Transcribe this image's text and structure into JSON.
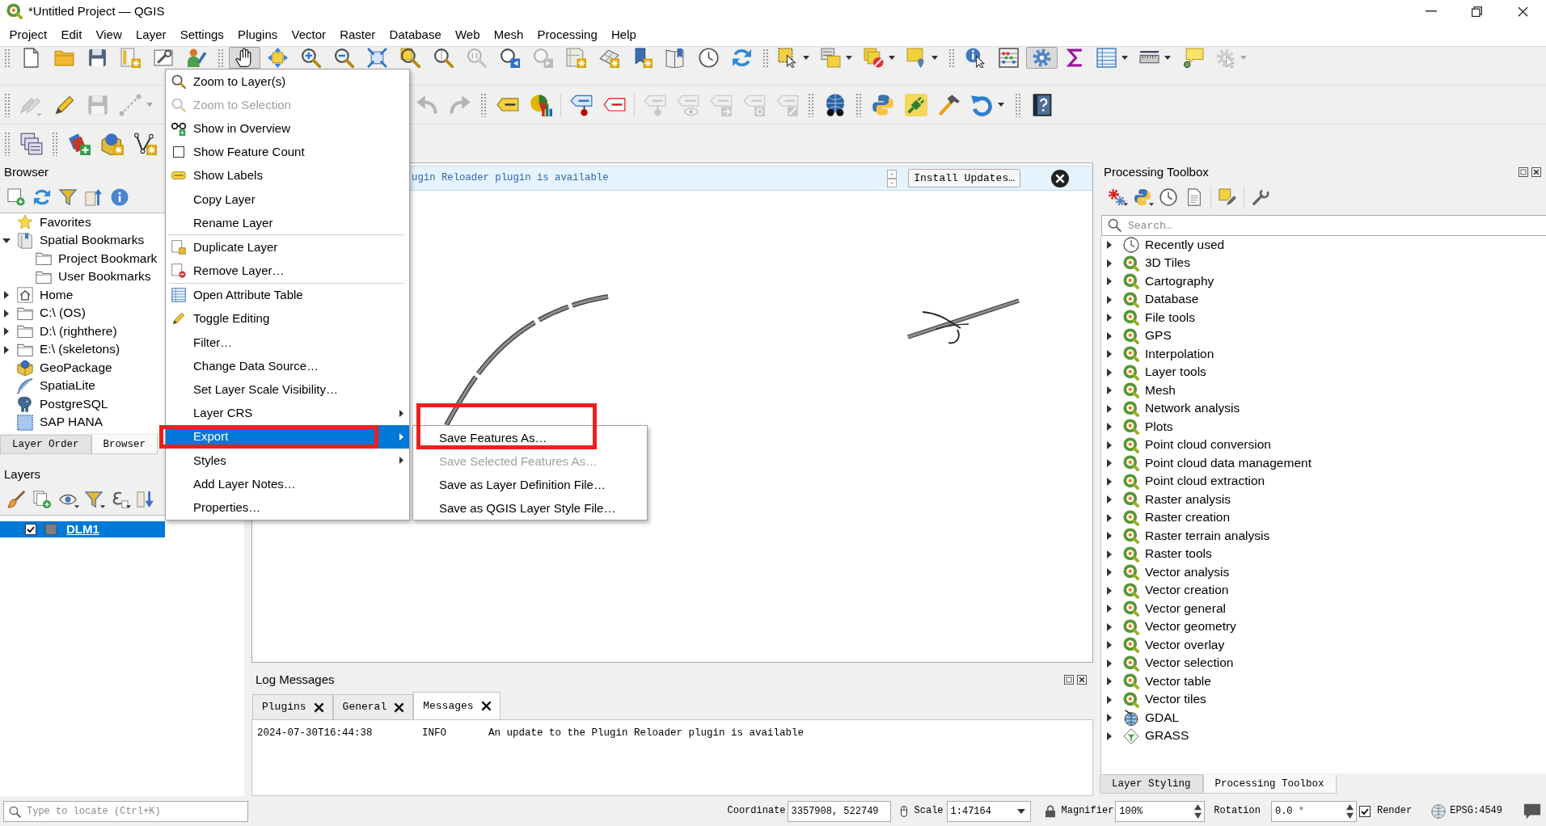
{
  "window": {
    "title": "*Untitled Project — QGIS"
  },
  "menu_bar": [
    {
      "label": "Project"
    },
    {
      "label": "Edit"
    },
    {
      "label": "View"
    },
    {
      "label": "Layer"
    },
    {
      "label": "Settings"
    },
    {
      "label": "Plugins"
    },
    {
      "label": "Vector"
    },
    {
      "label": "Raster"
    },
    {
      "label": "Database"
    },
    {
      "label": "Web"
    },
    {
      "label": "Mesh"
    },
    {
      "label": "Processing"
    },
    {
      "label": "Help"
    }
  ],
  "toolbars": [
    {
      "groups": [
        {
          "grip": true,
          "items": [
            {
              "kind": "new",
              "disabled": false,
              "pressed": false,
              "menu": false
            },
            {
              "kind": "open",
              "disabled": false,
              "pressed": false,
              "menu": false
            },
            {
              "kind": "save",
              "disabled": false,
              "pressed": false,
              "menu": false
            },
            {
              "kind": "template",
              "disabled": false,
              "pressed": false,
              "menu": false
            },
            {
              "kind": "style",
              "disabled": false,
              "pressed": false,
              "menu": false
            },
            {
              "kind": "profile",
              "disabled": false,
              "pressed": false,
              "menu": false
            }
          ]
        },
        {
          "grip": true,
          "items": [
            {
              "kind": "pan",
              "disabled": false,
              "pressed": true,
              "menu": false
            },
            {
              "kind": "pansel",
              "disabled": false,
              "pressed": false,
              "menu": false
            },
            {
              "kind": "zoomin",
              "disabled": false,
              "pressed": false,
              "menu": false
            },
            {
              "kind": "zoomout",
              "disabled": false,
              "pressed": false,
              "menu": false
            },
            {
              "kind": "zoomfull",
              "disabled": false,
              "pressed": false,
              "menu": false
            },
            {
              "kind": "zoomsel",
              "disabled": false,
              "pressed": false,
              "menu": false
            },
            {
              "kind": "zoomlayer",
              "disabled": false,
              "pressed": false,
              "menu": false
            },
            {
              "kind": "zoomnative",
              "disabled": true,
              "pressed": false,
              "menu": false
            },
            {
              "kind": "zoomlast",
              "disabled": false,
              "pressed": false,
              "menu": false
            },
            {
              "kind": "zoomnext",
              "disabled": true,
              "pressed": false,
              "menu": false
            },
            {
              "kind": "newmap",
              "disabled": false,
              "pressed": false,
              "menu": false
            },
            {
              "kind": "new3d",
              "disabled": false,
              "pressed": false,
              "menu": false
            },
            {
              "kind": "newbm",
              "disabled": false,
              "pressed": false,
              "menu": false
            },
            {
              "kind": "bookmarks",
              "disabled": false,
              "pressed": false,
              "menu": false
            },
            {
              "kind": "clock",
              "disabled": false,
              "pressed": false,
              "menu": false
            },
            {
              "kind": "refresh",
              "disabled": false,
              "pressed": false,
              "menu": false
            }
          ]
        },
        {
          "grip": true,
          "items": [
            {
              "kind": "select",
              "disabled": false,
              "pressed": false,
              "menu": true
            },
            {
              "kind": "selattr",
              "disabled": false,
              "pressed": false,
              "menu": true
            },
            {
              "kind": "deselect",
              "disabled": false,
              "pressed": false,
              "menu": true
            },
            {
              "kind": "selloc",
              "disabled": false,
              "pressed": false,
              "menu": true
            }
          ]
        },
        {
          "grip": true,
          "items": [
            {
              "kind": "identify",
              "disabled": false,
              "pressed": false,
              "menu": false
            },
            {
              "kind": "stats",
              "disabled": false,
              "pressed": false,
              "menu": false
            },
            {
              "kind": "toolbox",
              "disabled": false,
              "pressed": true,
              "menu": false
            },
            {
              "kind": "sigma",
              "disabled": false,
              "pressed": false,
              "menu": false
            },
            {
              "kind": "table",
              "disabled": false,
              "pressed": false,
              "menu": true
            },
            {
              "kind": "measure",
              "disabled": false,
              "pressed": false,
              "menu": true
            },
            {
              "kind": "maptips",
              "disabled": false,
              "pressed": false,
              "menu": false
            },
            {
              "kind": "action",
              "disabled": true,
              "pressed": false,
              "menu": true
            }
          ]
        }
      ]
    },
    {
      "groups": [
        {
          "grip": true,
          "items": [
            {
              "kind": "multiedit",
              "disabled": true,
              "pressed": false,
              "menu": false
            },
            {
              "kind": "pencil",
              "disabled": false,
              "pressed": false,
              "menu": false
            },
            {
              "kind": "saveedits",
              "disabled": true,
              "pressed": false,
              "menu": false
            },
            {
              "kind": "addfeat",
              "disabled": true,
              "pressed": false,
              "menu": true
            },
            {
              "kind": "undo",
              "disabled": true,
              "pressed": false,
              "menu": false
            },
            {
              "kind": "redo",
              "disabled": true,
              "pressed": false,
              "menu": false
            }
          ]
        },
        {
          "grip": true,
          "items": [
            {
              "kind": "label",
              "disabled": false,
              "pressed": false,
              "menu": false
            },
            {
              "kind": "diagram",
              "disabled": false,
              "pressed": false,
              "menu": false
            },
            {
              "kind": "separator"
            },
            {
              "kind": "labelpin",
              "disabled": false,
              "pressed": false,
              "menu": false
            },
            {
              "kind": "labelred",
              "disabled": false,
              "pressed": false,
              "menu": false
            },
            {
              "kind": "separator"
            },
            {
              "kind": "lblpin",
              "disabled": true,
              "pressed": false,
              "menu": false
            },
            {
              "kind": "lbleye",
              "disabled": true,
              "pressed": false,
              "menu": false
            },
            {
              "kind": "lblarrow",
              "disabled": true,
              "pressed": false,
              "menu": false
            },
            {
              "kind": "lblrot",
              "disabled": true,
              "pressed": false,
              "menu": false
            },
            {
              "kind": "lblpen",
              "disabled": true,
              "pressed": false,
              "menu": false
            }
          ]
        },
        {
          "grip": true,
          "items": [
            {
              "kind": "globe",
              "disabled": false,
              "pressed": false,
              "menu": false
            }
          ]
        },
        {
          "grip": true,
          "items": [
            {
              "kind": "python",
              "disabled": false,
              "pressed": false,
              "menu": false
            },
            {
              "kind": "plugin",
              "disabled": false,
              "pressed": false,
              "menu": false
            },
            {
              "kind": "hammer",
              "disabled": false,
              "pressed": false,
              "menu": false
            },
            {
              "kind": "reload",
              "disabled": false,
              "pressed": false,
              "menu": true
            }
          ]
        },
        {
          "grip": true,
          "items": [
            {
              "kind": "help",
              "disabled": false,
              "pressed": false,
              "menu": false
            }
          ]
        }
      ]
    },
    {
      "groups": [
        {
          "grip": true,
          "items": [
            {
              "kind": "layerstack",
              "disabled": false,
              "pressed": false,
              "menu": false
            }
          ]
        },
        {
          "grip": true,
          "items": [
            {
              "kind": "addlayer",
              "disabled": false,
              "pressed": false,
              "menu": false
            },
            {
              "kind": "globebox",
              "disabled": false,
              "pressed": false,
              "menu": false
            },
            {
              "kind": "vertex",
              "disabled": false,
              "pressed": false,
              "menu": false
            }
          ]
        }
      ]
    }
  ],
  "browser": {
    "title": "Browser",
    "toolbar": [
      {
        "kind": "addsheet",
        "menu": false
      },
      {
        "kind": "refresh",
        "menu": false
      },
      {
        "kind": "filter",
        "menu": false
      },
      {
        "kind": "collapse",
        "menu": false
      },
      {
        "kind": "info",
        "menu": false
      }
    ],
    "items": [
      {
        "label": "Favorites",
        "kind": "favorites"
      },
      {
        "label": "Spatial Bookmarks",
        "kind": "bookmarks",
        "expanded": true,
        "children": [
          {
            "label": "Project Bookmark",
            "kind": "folder"
          },
          {
            "label": "User Bookmarks",
            "kind": "folder"
          }
        ]
      },
      {
        "label": "Home",
        "kind": "home",
        "expanded": false
      },
      {
        "label": "C:\\ (OS)",
        "kind": "drive",
        "expanded": false
      },
      {
        "label": "D:\\ (righthere)",
        "kind": "drive",
        "expanded": false
      },
      {
        "label": "E:\\ (skeletons)",
        "kind": "drive",
        "expanded": false
      },
      {
        "label": "GeoPackage",
        "kind": "geopackage"
      },
      {
        "label": "SpatiaLite",
        "kind": "spatialite"
      },
      {
        "label": "PostgreSQL",
        "kind": "postgres"
      },
      {
        "label": "SAP HANA",
        "kind": "hana"
      }
    ],
    "tabs": [
      {
        "label": "Layer Order",
        "selected": false
      },
      {
        "label": "Browser",
        "selected": true
      }
    ]
  },
  "layers": {
    "title": "Layers",
    "toolbar": [
      {
        "kind": "brush",
        "menu": false
      },
      {
        "kind": "addgroup",
        "menu": false
      },
      {
        "kind": "eye",
        "menu": true
      },
      {
        "kind": "filter",
        "menu": true
      },
      {
        "kind": "epsilon",
        "menu": true
      },
      {
        "kind": "down",
        "menu": false
      }
    ],
    "items": [
      {
        "name": "DLM1",
        "checked": true,
        "selected": true
      }
    ]
  },
  "map": {
    "message_bar": {
      "text": "ugin Reloader plugin is available",
      "button": "Install Updates…"
    }
  },
  "log_messages": {
    "title": "Log Messages",
    "tabs": [
      {
        "label": "Plugins",
        "selected": false
      },
      {
        "label": "General",
        "selected": false
      },
      {
        "label": "Messages",
        "selected": true
      }
    ],
    "rows": [
      {
        "time": "2024-07-30T16:44:38",
        "level": "INFO",
        "message": "An update to the Plugin Reloader plugin is available"
      }
    ]
  },
  "processing_toolbox": {
    "title": "Processing Toolbox",
    "toolbar": [
      {
        "kind": "gears",
        "menu": true
      },
      {
        "kind": "python",
        "menu": true
      },
      {
        "kind": "clock",
        "menu": false
      },
      {
        "kind": "doc",
        "menu": false
      },
      {
        "kind": "separator"
      },
      {
        "kind": "tagpen",
        "menu": false
      },
      {
        "kind": "separator"
      },
      {
        "kind": "wrench",
        "menu": false
      }
    ],
    "search": {
      "placeholder": "Search…"
    },
    "items": [
      {
        "label": "Recently used",
        "kind": "recent",
        "expanded": false
      },
      {
        "label": "3D Tiles",
        "kind": "provider",
        "expanded": false
      },
      {
        "label": "Cartography",
        "kind": "provider",
        "expanded": false
      },
      {
        "label": "Database",
        "kind": "provider",
        "expanded": false
      },
      {
        "label": "File tools",
        "kind": "provider",
        "expanded": false
      },
      {
        "label": "GPS",
        "kind": "provider",
        "expanded": false
      },
      {
        "label": "Interpolation",
        "kind": "provider",
        "expanded": false
      },
      {
        "label": "Layer tools",
        "kind": "provider",
        "expanded": false
      },
      {
        "label": "Mesh",
        "kind": "provider",
        "expanded": false
      },
      {
        "label": "Network analysis",
        "kind": "provider",
        "expanded": false
      },
      {
        "label": "Plots",
        "kind": "provider",
        "expanded": false
      },
      {
        "label": "Point cloud conversion",
        "kind": "provider",
        "expanded": false
      },
      {
        "label": "Point cloud data management",
        "kind": "provider",
        "expanded": false
      },
      {
        "label": "Point cloud extraction",
        "kind": "provider",
        "expanded": false
      },
      {
        "label": "Raster analysis",
        "kind": "provider",
        "expanded": false
      },
      {
        "label": "Raster creation",
        "kind": "provider",
        "expanded": false
      },
      {
        "label": "Raster terrain analysis",
        "kind": "provider",
        "expanded": false
      },
      {
        "label": "Raster tools",
        "kind": "provider",
        "expanded": false
      },
      {
        "label": "Vector analysis",
        "kind": "provider",
        "expanded": false
      },
      {
        "label": "Vector creation",
        "kind": "provider",
        "expanded": false
      },
      {
        "label": "Vector general",
        "kind": "provider",
        "expanded": false
      },
      {
        "label": "Vector geometry",
        "kind": "provider",
        "expanded": false
      },
      {
        "label": "Vector overlay",
        "kind": "provider",
        "expanded": false
      },
      {
        "label": "Vector selection",
        "kind": "provider",
        "expanded": false
      },
      {
        "label": "Vector table",
        "kind": "provider",
        "expanded": false
      },
      {
        "label": "Vector tiles",
        "kind": "provider",
        "expanded": false
      },
      {
        "label": "GDAL",
        "kind": "gdal",
        "expanded": false
      },
      {
        "label": "GRASS",
        "kind": "grass",
        "expanded": false
      }
    ]
  },
  "right_dock_tabs": [
    {
      "label": "Layer Styling",
      "selected": false
    },
    {
      "label": "Processing Toolbox",
      "selected": true
    }
  ],
  "status_bar": {
    "locate": {
      "placeholder": "Type to locate (Ctrl+K)"
    },
    "coordinate_label": "Coordinate",
    "coordinate": "3357908, 522749",
    "scale_label": "Scale",
    "scale": "1:47164",
    "magnifier_label": "Magnifier",
    "magnifier": "100%",
    "rotation_label": "Rotation",
    "rotation": "0.0 °",
    "render": {
      "label": "Render",
      "checked": true
    },
    "crs": "EPSG:4549"
  },
  "context_menu": {
    "items": [
      {
        "kind": "zoom",
        "label": "Zoom to Layer(s)",
        "disabled": false,
        "selected": false,
        "submenu": false,
        "outlined": false
      },
      {
        "kind": "zoom",
        "label": "Zoom to Selection",
        "disabled": true,
        "selected": false,
        "submenu": false,
        "outlined": false
      },
      {
        "kind": "overview",
        "label": "Show in Overview",
        "disabled": false,
        "selected": false,
        "submenu": false,
        "outlined": false
      },
      {
        "kind": "check",
        "label": "Show Feature Count",
        "checked": false,
        "disabled": false,
        "selected": false,
        "submenu": false,
        "outlined": false
      },
      {
        "kind": "labels",
        "label": "Show Labels",
        "disabled": false,
        "selected": false,
        "submenu": false,
        "outlined": false
      },
      {
        "kind": "plain",
        "label": "Copy Layer",
        "disabled": false,
        "selected": false,
        "submenu": false,
        "outlined": false
      },
      {
        "kind": "plain",
        "label": "Rename Layer",
        "disabled": false,
        "selected": false,
        "submenu": false,
        "outlined": false
      },
      {
        "kind": "separator"
      },
      {
        "kind": "duplicate",
        "label": "Duplicate Layer",
        "disabled": false,
        "selected": false,
        "submenu": false,
        "outlined": false
      },
      {
        "kind": "remove",
        "label": "Remove Layer…",
        "disabled": false,
        "selected": false,
        "submenu": false,
        "outlined": false
      },
      {
        "kind": "separator"
      },
      {
        "kind": "table",
        "label": "Open Attribute Table",
        "disabled": false,
        "selected": false,
        "submenu": false,
        "outlined": false
      },
      {
        "kind": "pencil",
        "label": "Toggle Editing",
        "disabled": false,
        "selected": false,
        "submenu": false,
        "outlined": false
      },
      {
        "kind": "plain",
        "label": "Filter…",
        "disabled": false,
        "selected": false,
        "submenu": false,
        "outlined": false
      },
      {
        "kind": "plain",
        "label": "Change Data Source…",
        "disabled": false,
        "selected": false,
        "submenu": false,
        "outlined": false
      },
      {
        "kind": "plain",
        "label": "Set Layer Scale Visibility…",
        "disabled": false,
        "selected": false,
        "submenu": false,
        "outlined": false
      },
      {
        "kind": "plain",
        "label": "Layer CRS",
        "disabled": false,
        "selected": false,
        "submenu": true,
        "outlined": false
      },
      {
        "kind": "plain",
        "label": "Export",
        "disabled": false,
        "selected": true,
        "submenu": true,
        "outlined": true,
        "submenu_items": [
          {
            "label": "Save Features As…",
            "disabled": false,
            "outlined": true
          },
          {
            "label": "Save Selected Features As…",
            "disabled": true,
            "outlined": false
          },
          {
            "label": "Save as Layer Definition File…",
            "disabled": false,
            "outlined": false
          },
          {
            "label": "Save as QGIS Layer Style File…",
            "disabled": false,
            "outlined": false
          }
        ]
      },
      {
        "kind": "plain",
        "label": "Styles",
        "disabled": false,
        "selected": false,
        "submenu": true,
        "outlined": false
      },
      {
        "kind": "plain",
        "label": "Add Layer Notes…",
        "disabled": false,
        "selected": false,
        "submenu": false,
        "outlined": false
      },
      {
        "kind": "plain",
        "label": "Properties…",
        "disabled": false,
        "selected": false,
        "submenu": false,
        "outlined": false
      }
    ]
  }
}
